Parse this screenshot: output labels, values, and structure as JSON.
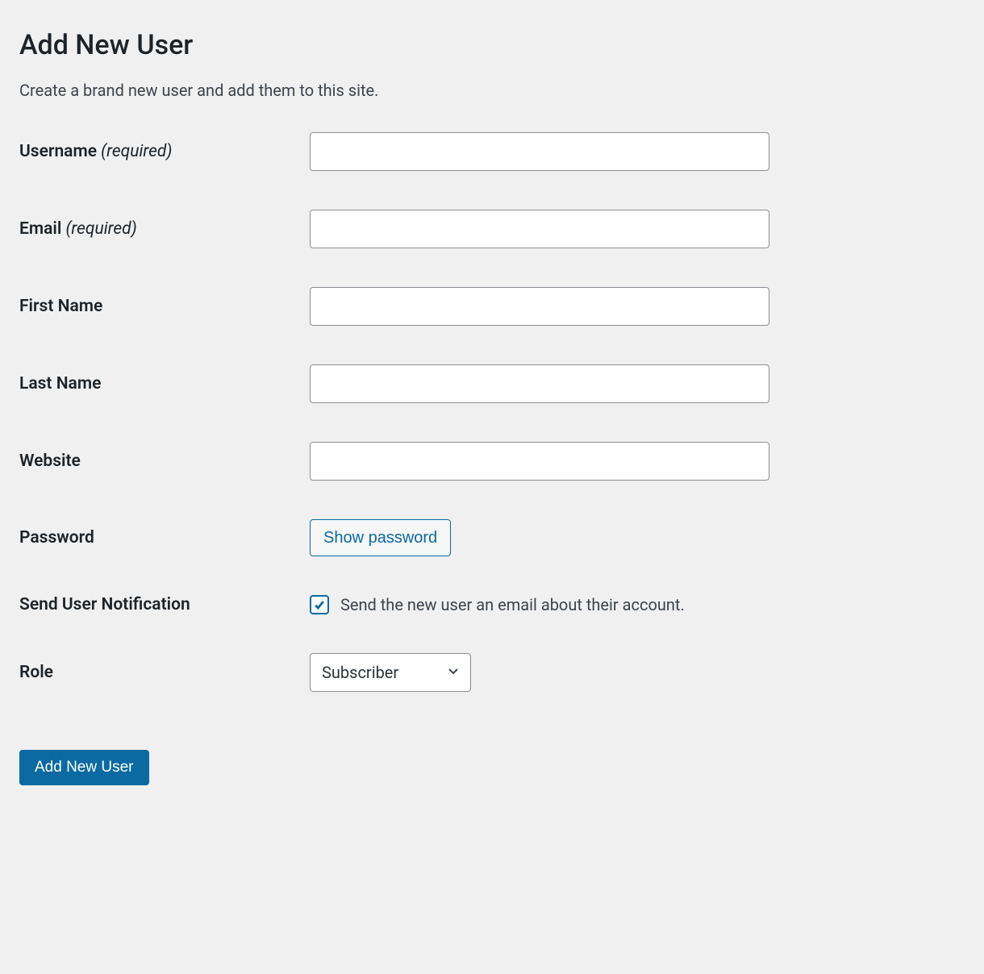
{
  "page": {
    "title": "Add New User",
    "description": "Create a brand new user and add them to this site."
  },
  "form": {
    "username": {
      "label": "Username",
      "required_suffix": " (required)",
      "value": ""
    },
    "email": {
      "label": "Email",
      "required_suffix": " (required)",
      "value": ""
    },
    "first_name": {
      "label": "First Name",
      "value": ""
    },
    "last_name": {
      "label": "Last Name",
      "value": ""
    },
    "website": {
      "label": "Website",
      "value": ""
    },
    "password": {
      "label": "Password",
      "show_button": "Show password"
    },
    "notification": {
      "label": "Send User Notification",
      "checkbox_label": "Send the new user an email about their account.",
      "checked": true
    },
    "role": {
      "label": "Role",
      "selected": "Subscriber"
    },
    "submit_label": "Add New User"
  }
}
